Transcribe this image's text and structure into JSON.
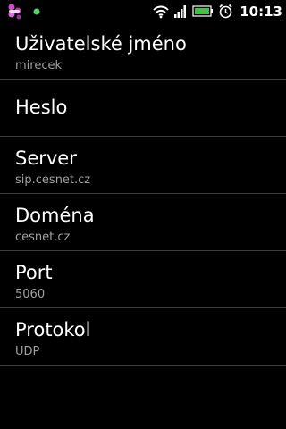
{
  "status_bar": {
    "time": "10:13",
    "icons": [
      "app-notification-icon",
      "notification-dot-icon",
      "wifi-icon",
      "signal-icon",
      "battery-icon",
      "alarm-icon"
    ],
    "colors": {
      "notification_dot": "#4cd964",
      "battery_fill": "#3ec43e",
      "app_icon": "#c040c0"
    }
  },
  "preferences": [
    {
      "title": "Uživatelské jméno",
      "summary": "mirecek"
    },
    {
      "title": "Heslo",
      "summary": ""
    },
    {
      "title": "Server",
      "summary": "sip.cesnet.cz"
    },
    {
      "title": "Doména",
      "summary": "cesnet.cz"
    },
    {
      "title": "Port",
      "summary": "5060"
    },
    {
      "title": "Protokol",
      "summary": "UDP"
    }
  ]
}
